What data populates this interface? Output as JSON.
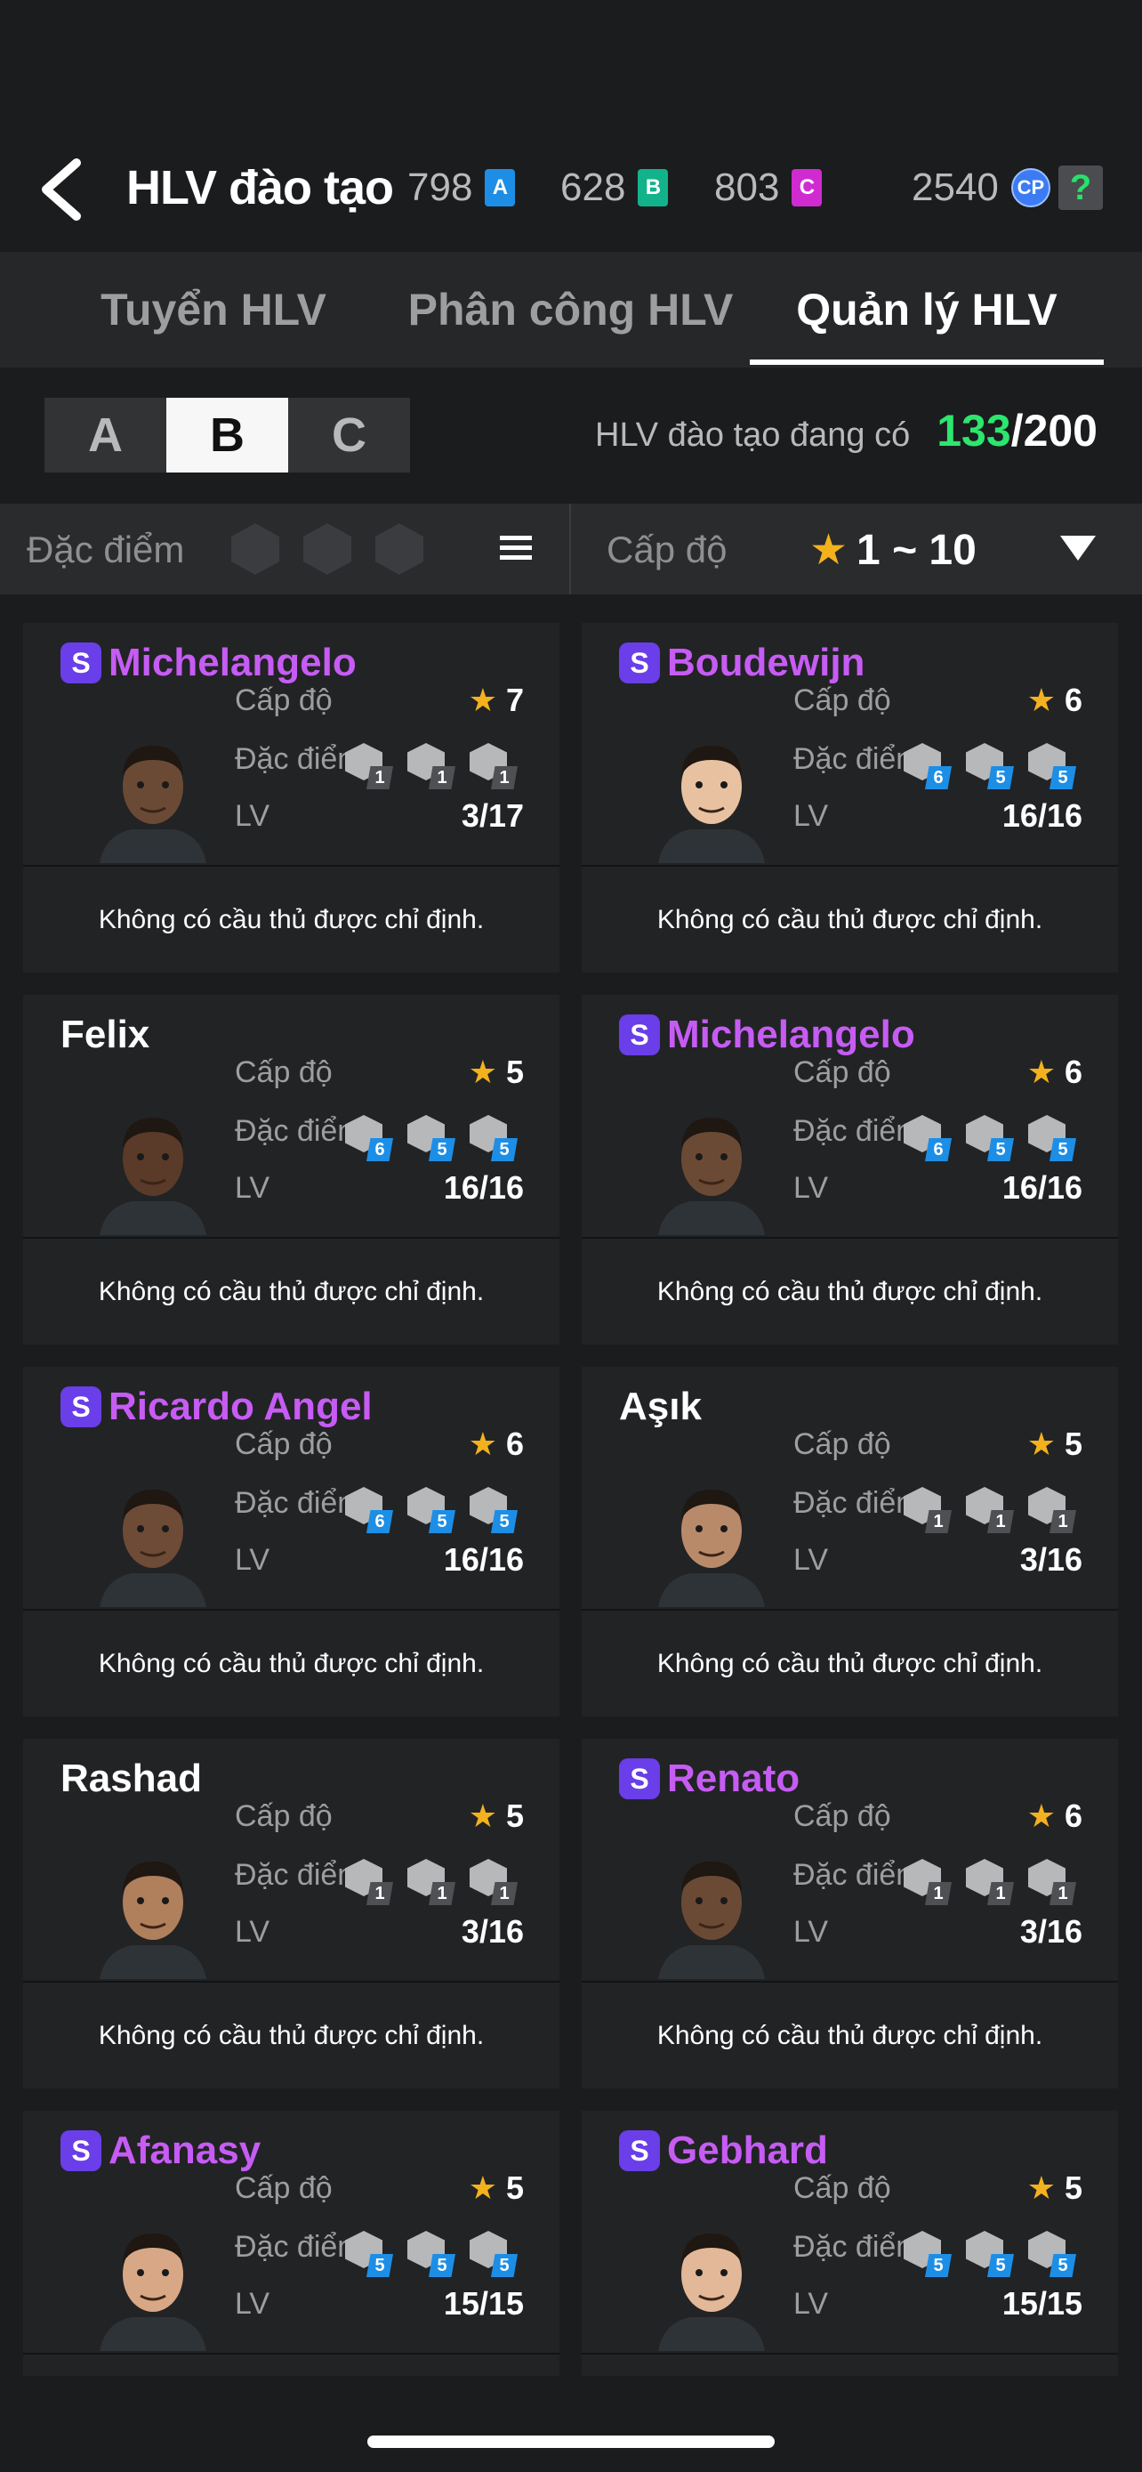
{
  "header": {
    "title": "HLV đào tạo",
    "resources": [
      {
        "value": "798",
        "icon": "A",
        "color": "#1d8ee6"
      },
      {
        "value": "628",
        "icon": "B",
        "color": "#12b38a"
      },
      {
        "value": "803",
        "icon": "C",
        "color": "#cf2bd0"
      },
      {
        "value": "2540",
        "icon": "CP",
        "color": "#3b7cf5"
      }
    ],
    "help": "?"
  },
  "tabs": [
    {
      "label": "Tuyển HLV",
      "active": false
    },
    {
      "label": "Phân công HLV",
      "active": false
    },
    {
      "label": "Quản lý HLV",
      "active": true
    }
  ],
  "grades": [
    {
      "label": "A",
      "active": false
    },
    {
      "label": "B",
      "active": true
    },
    {
      "label": "C",
      "active": false
    }
  ],
  "owned": {
    "label": "HLV đào tạo đang có",
    "current": "133",
    "max": "/200"
  },
  "filter": {
    "trait_label": "Đặc điểm c",
    "level_label": "Cấp độ",
    "level_range": "1 ~ 10"
  },
  "labels": {
    "level": "Cấp độ",
    "trait": "Đặc điểm",
    "lv": "LV",
    "assign": "Không có cầu thủ được chỉ định."
  },
  "coaches": [
    {
      "name": "Michelangelo",
      "special": true,
      "level": "7",
      "lv": "3/17",
      "traits": [
        "1",
        "1",
        "1"
      ],
      "trait_color": "gray"
    },
    {
      "name": "Boudewijn",
      "special": true,
      "level": "6",
      "lv": "16/16",
      "traits": [
        "6",
        "5",
        "5"
      ],
      "trait_color": "blue"
    },
    {
      "name": "Felix",
      "special": false,
      "level": "5",
      "lv": "16/16",
      "traits": [
        "6",
        "5",
        "5"
      ],
      "trait_color": "blue"
    },
    {
      "name": "Michelangelo",
      "special": true,
      "level": "6",
      "lv": "16/16",
      "traits": [
        "6",
        "5",
        "5"
      ],
      "trait_color": "blue"
    },
    {
      "name": "Ricardo Angel",
      "special": true,
      "level": "6",
      "lv": "16/16",
      "traits": [
        "6",
        "5",
        "5"
      ],
      "trait_color": "blue"
    },
    {
      "name": "Aşık",
      "special": false,
      "level": "5",
      "lv": "3/16",
      "traits": [
        "1",
        "1",
        "1"
      ],
      "trait_color": "gray"
    },
    {
      "name": "Rashad",
      "special": false,
      "level": "5",
      "lv": "3/16",
      "traits": [
        "1",
        "1",
        "1"
      ],
      "trait_color": "gray"
    },
    {
      "name": "Renato",
      "special": true,
      "level": "6",
      "lv": "3/16",
      "traits": [
        "1",
        "1",
        "1"
      ],
      "trait_color": "gray"
    },
    {
      "name": "Afanasy",
      "special": true,
      "level": "5",
      "lv": "15/15",
      "traits": [
        "5",
        "5",
        "5"
      ],
      "trait_color": "blue"
    },
    {
      "name": "Gebhard",
      "special": true,
      "level": "5",
      "lv": "15/15",
      "traits": [
        "5",
        "5",
        "5"
      ],
      "trait_color": "blue"
    }
  ],
  "colors": {
    "accent_green": "#2ce66e",
    "special_name": "#c65cf4",
    "star": "#f3b21d"
  }
}
